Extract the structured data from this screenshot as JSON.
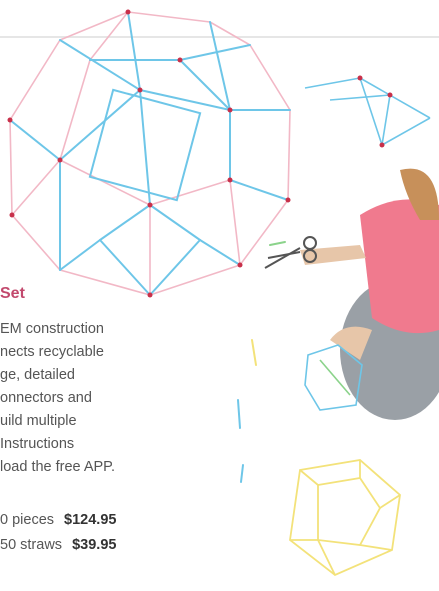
{
  "product": {
    "title": "Set",
    "description_lines": [
      "EM construction",
      "nects recyclable",
      "ge, detailed",
      "onnectors and",
      "uild multiple",
      " Instructions",
      "load the free APP."
    ],
    "prices": [
      {
        "label": "0 pieces",
        "price": "$124.95"
      },
      {
        "label": "50 straws",
        "price": "$39.95"
      }
    ]
  },
  "colors": {
    "accent": "#c2496d",
    "straw_blue": "#6ec6e8",
    "straw_pink": "#f2b8c6",
    "straw_yellow": "#f3e27a",
    "connector": "#c8304a"
  }
}
